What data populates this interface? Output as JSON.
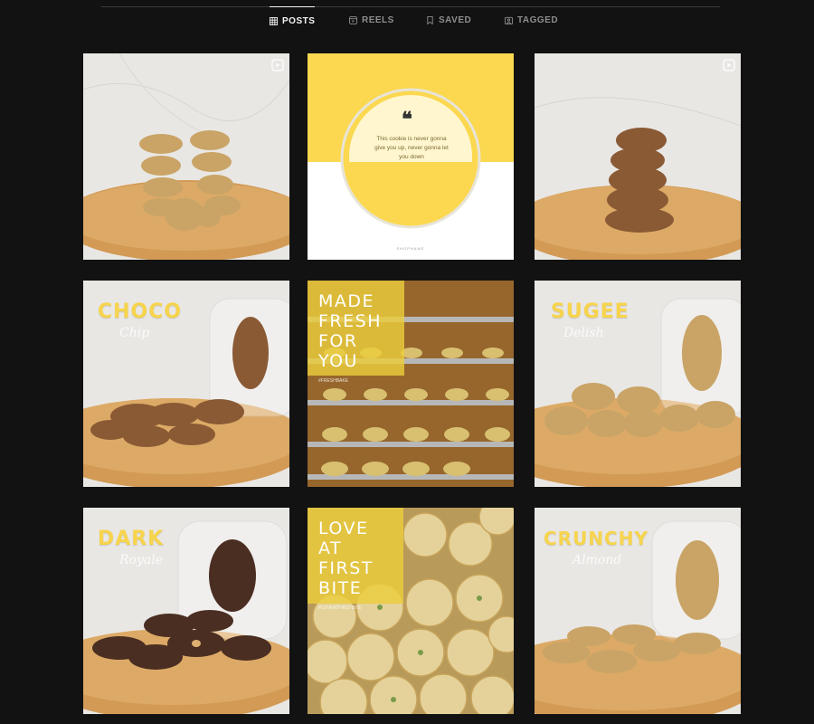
{
  "tabs": [
    {
      "label": "POSTS",
      "icon": "grid-icon",
      "active": true
    },
    {
      "label": "REELS",
      "icon": "reels-icon",
      "active": false
    },
    {
      "label": "SAVED",
      "icon": "bookmark-icon",
      "active": false
    },
    {
      "label": "TAGGED",
      "icon": "tag-icon",
      "active": false
    }
  ],
  "posts": [
    {
      "type": "reel",
      "subject": "stacked-cookies-golden"
    },
    {
      "type": "quote",
      "quote": "This cookie is never gonna give you up, never gonna let you down",
      "footer": "SHOPNAME"
    },
    {
      "type": "reel",
      "subject": "stacked-cookies-brown"
    },
    {
      "type": "product",
      "title": "CHOCO",
      "subtitle": "Chip"
    },
    {
      "type": "banner",
      "text": "MADE\nFRESH\nFOR YOU",
      "small": "#FRESHBAKE"
    },
    {
      "type": "product",
      "title": "SUGEE",
      "subtitle": "Delish"
    },
    {
      "type": "product",
      "title": "DARK",
      "subtitle": "Royale"
    },
    {
      "type": "banner",
      "text": "LOVE AT\nFIRST\nBITE",
      "small": "#LOVEATFIRSTBITE"
    },
    {
      "type": "product",
      "title": "CRUNCHY",
      "subtitle": "Almond"
    }
  ],
  "colors": {
    "background": "#121212",
    "accent_yellow": "#f7d44c",
    "wood": "#d9a45e",
    "marble": "#eceae7"
  }
}
